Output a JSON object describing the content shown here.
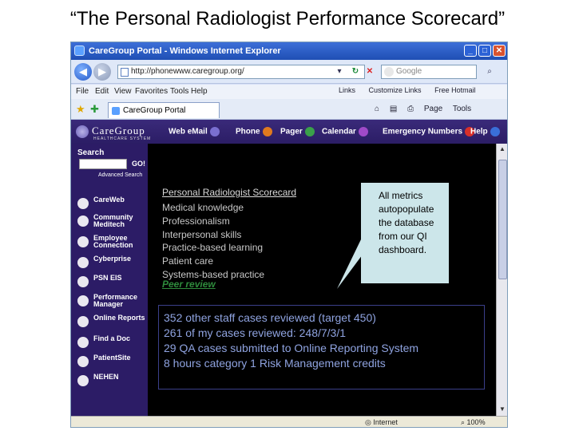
{
  "slide": {
    "title": "“The Personal Radiologist Performance Scorecard”"
  },
  "browser": {
    "window_title": "CareGroup Portal - Windows Internet Explorer",
    "url": "http://phonewww.caregroup.org/",
    "search_placeholder": "Google",
    "menu": [
      "File",
      "Edit",
      "View",
      "Favorites",
      "Tools",
      "Help"
    ],
    "links_bar": [
      "Links",
      "Customize Links",
      "Free Hotmail"
    ],
    "tab_label": "CareGroup Portal",
    "command_items": [
      "Page",
      "Tools"
    ],
    "status_zone": "Internet",
    "status_zoom": "100%"
  },
  "portal": {
    "logo_name": "CareGroup",
    "logo_sub": "HEALTHCARE SYSTEM",
    "header_links": [
      "Web eMail",
      "Phone",
      "Pager",
      "Calendar",
      "Emergency Numbers",
      "Help"
    ],
    "search_label": "Search",
    "search_go": "GO!",
    "advanced_search": "Advanced Search",
    "sidebar_items": [
      "CareWeb",
      "Community Meditech",
      "Employee Connection",
      "Cyberprise",
      "PSN EIS",
      "Performance Manager",
      "Online Reports",
      "Find a Doc",
      "PatientSite",
      "NEHEN"
    ]
  },
  "scorecard": {
    "title": "Personal Radiologist Scorecard",
    "metrics": [
      "Medical knowledge",
      "Professionalism",
      "Interpersonal skills",
      "Practice-based learning",
      "Patient care",
      "Systems-based practice"
    ],
    "peer_review_link": "Peer review"
  },
  "callout": {
    "text": "All metrics autopopulate the database from our QI dashboard."
  },
  "peer_review_stats": [
    "352 other staff cases reviewed (target 450)",
    "261 of my cases reviewed: 248/7/3/1",
    "29 QA cases submitted to Online Reporting System",
    "8 hours category 1 Risk Management credits"
  ],
  "colors": {
    "portal_background": "#2a1a5e",
    "callout_background": "#cce6ea",
    "peer_review_green": "#2e8b3c",
    "stats_text": "#8fa3e0"
  }
}
